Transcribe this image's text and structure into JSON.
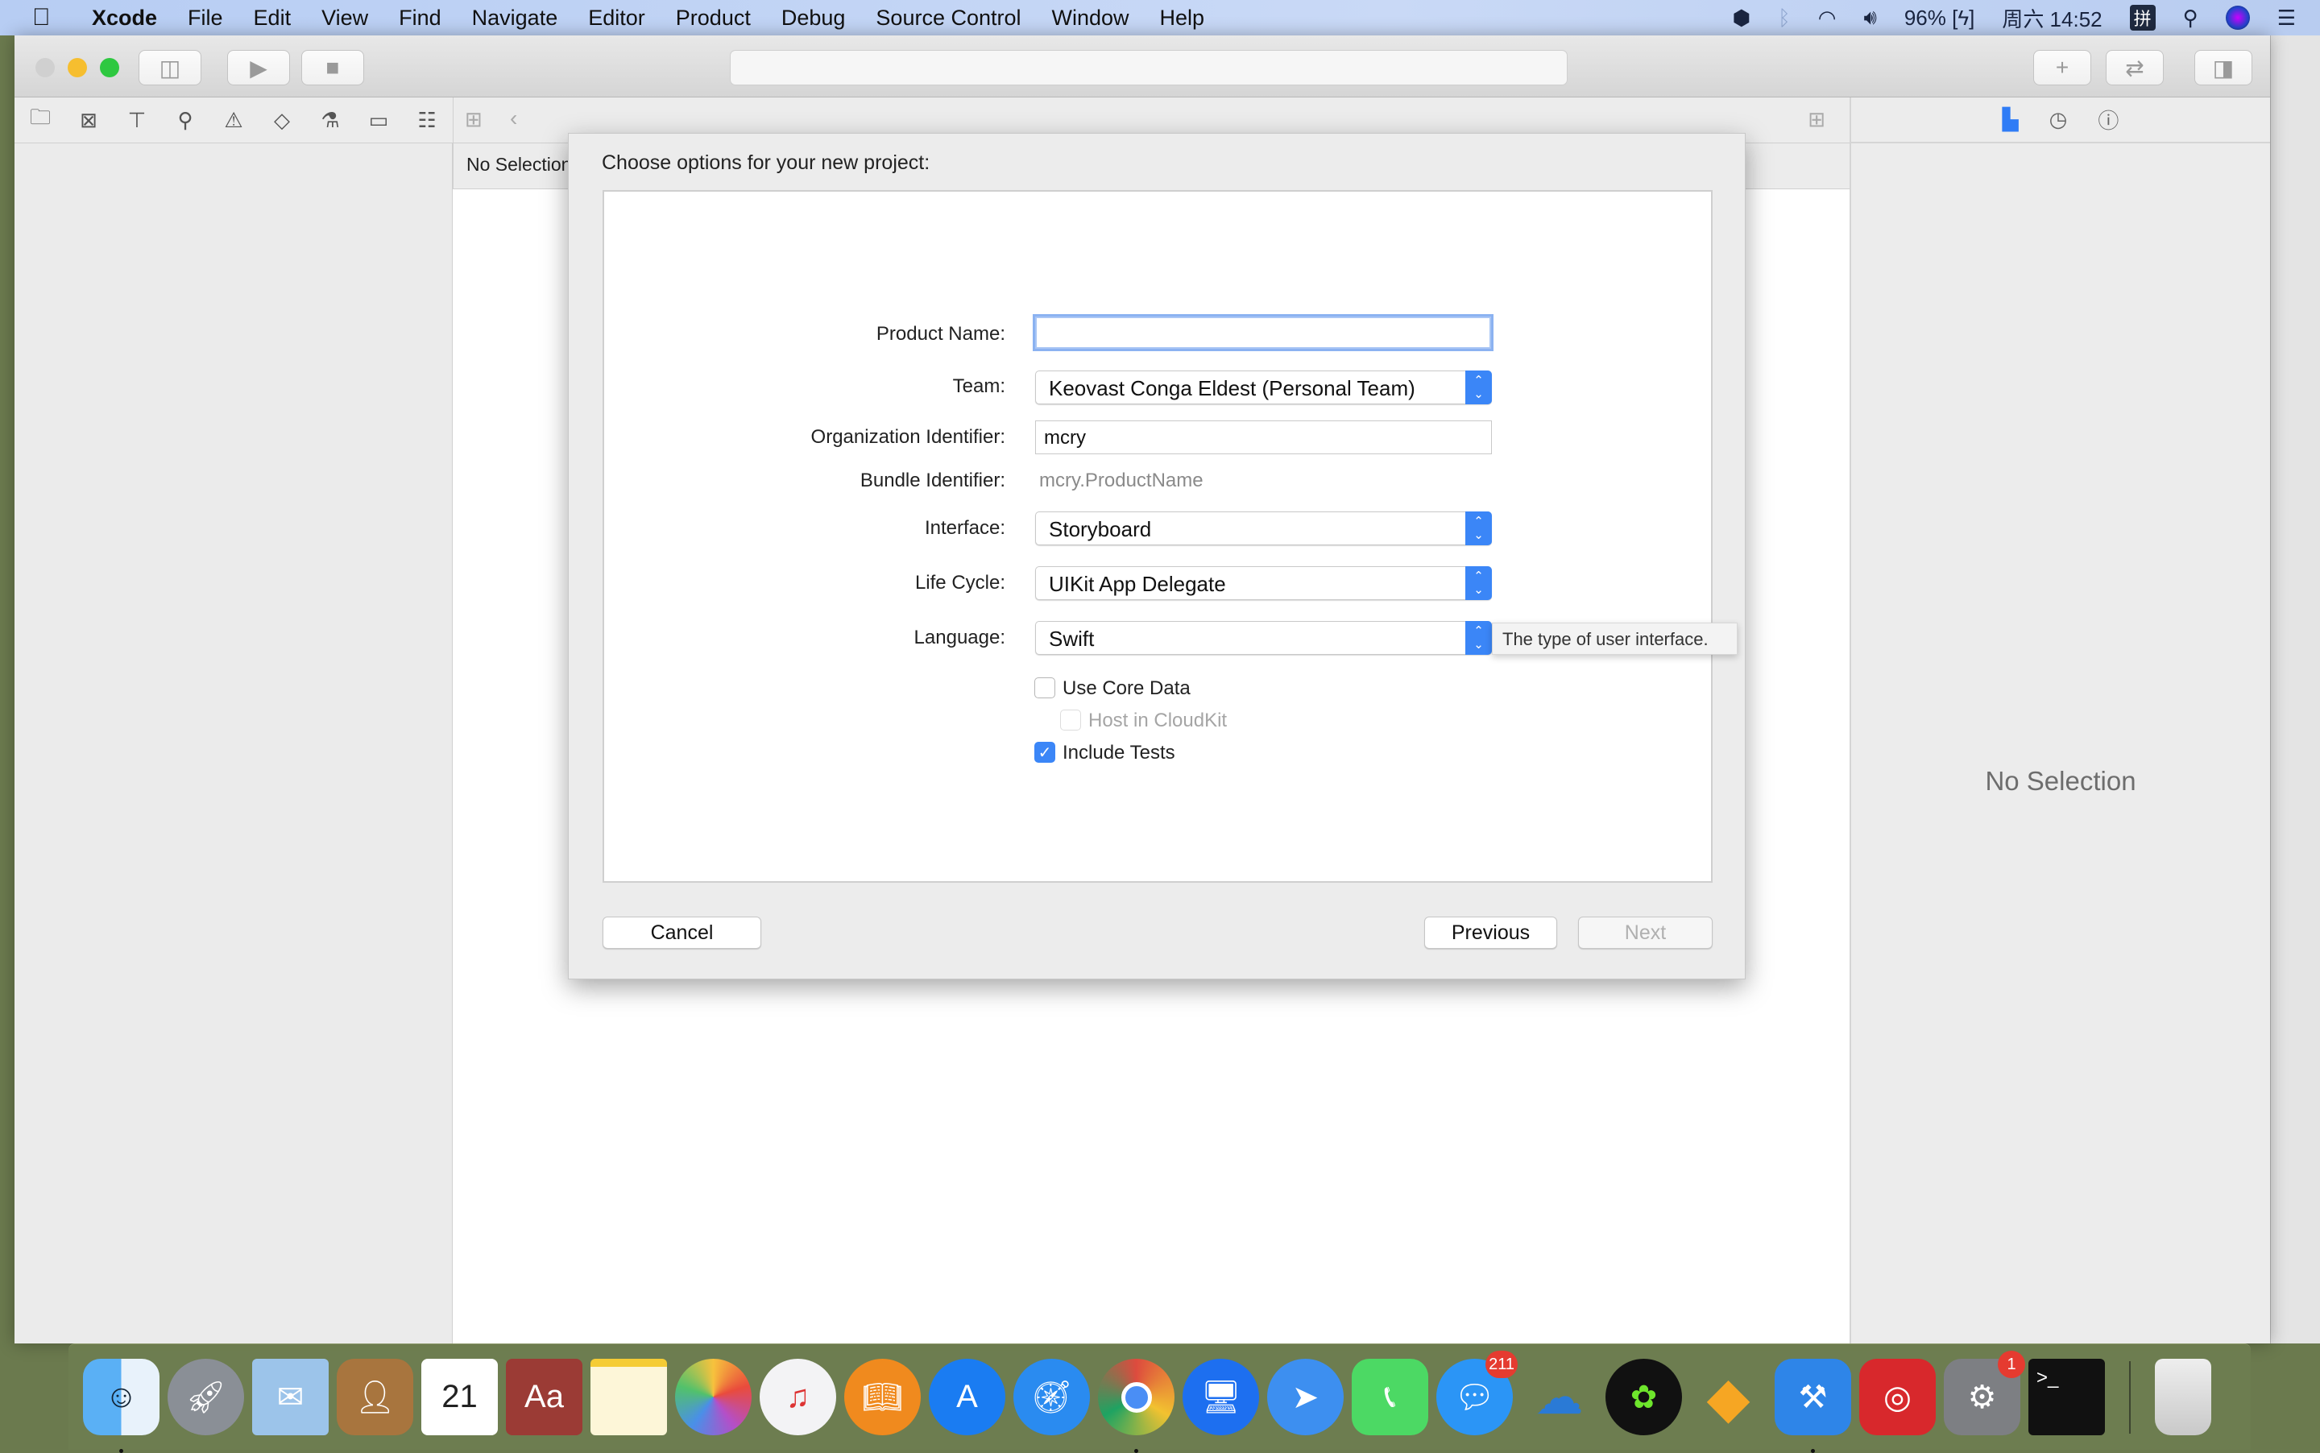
{
  "menubar": {
    "app": "Xcode",
    "items": [
      "File",
      "Edit",
      "View",
      "Find",
      "Navigate",
      "Editor",
      "Product",
      "Debug",
      "Source Control",
      "Window",
      "Help"
    ],
    "battery": "96%",
    "clock": "周六 14:52",
    "input_method": "拼"
  },
  "jumpbar": {
    "text": "No Selection"
  },
  "inspector": {
    "empty_text": "No Selection"
  },
  "dialog": {
    "title": "Choose options for your new project:",
    "fields": {
      "product_name": {
        "label": "Product Name:",
        "value": ""
      },
      "team": {
        "label": "Team:",
        "value": "Keovast Conga Eldest (Personal Team)"
      },
      "org_id": {
        "label": "Organization Identifier:",
        "value": "mcry"
      },
      "bundle_id": {
        "label": "Bundle Identifier:",
        "value": "mcry.ProductName"
      },
      "interface": {
        "label": "Interface:",
        "value": "Storyboard"
      },
      "life_cycle": {
        "label": "Life Cycle:",
        "value": "UIKit App Delegate"
      },
      "language": {
        "label": "Language:",
        "value": "Swift"
      }
    },
    "checkboxes": {
      "core_data": {
        "label": "Use Core Data",
        "checked": false
      },
      "cloudkit": {
        "label": "Host in CloudKit",
        "checked": false,
        "enabled": false
      },
      "tests": {
        "label": "Include Tests",
        "checked": true
      }
    },
    "tooltip": "The type of user interface.",
    "buttons": {
      "cancel": "Cancel",
      "previous": "Previous",
      "next": "Next"
    }
  },
  "dock": {
    "badges": {
      "messages": "211",
      "system_preferences": "1"
    }
  },
  "colors": {
    "accent": "#3b86f7",
    "focus_ring": "#8bb2f1"
  }
}
